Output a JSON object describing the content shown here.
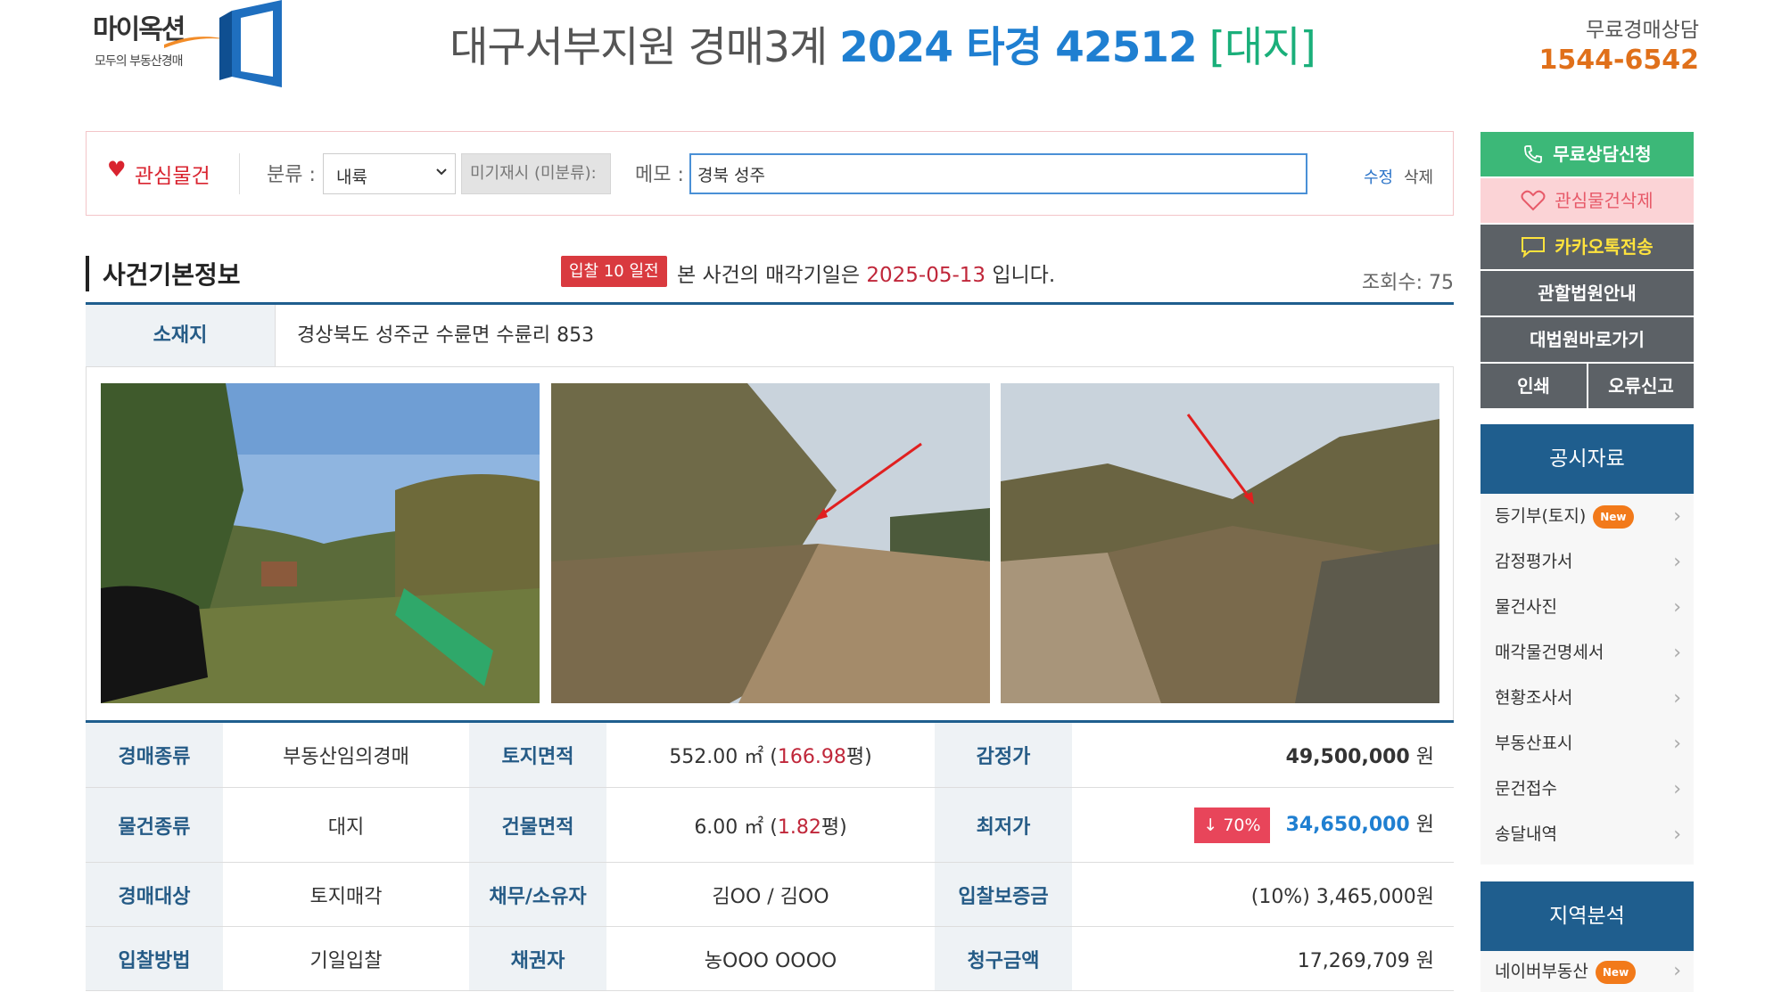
{
  "logo": {
    "main": "마이옥션",
    "sub": "모두의 부동산경매"
  },
  "header": {
    "court": "대구서부지원 경매3계",
    "case_no": "2024 타경 42512",
    "category": "[대지]",
    "consult_label": "무료경매상담",
    "consult_phone": "1544-6542"
  },
  "favorite": {
    "label": "관심물건",
    "category_label": "분류 :",
    "category_value": "내륙",
    "unclassified": "미기재시 (미분류):",
    "memo_label": "메모 :",
    "memo_value": "경북 성주",
    "edit": "수정",
    "delete": "삭제"
  },
  "section": {
    "title": "사건기본정보",
    "badge": "입찰 10 일전",
    "sale_prefix": "본 사건의 매각기일은",
    "sale_date": "2025-05-13",
    "sale_suffix": "입니다.",
    "view_count": "조회수: 75"
  },
  "location": {
    "label": "소재지",
    "value": "경상북도 성주군 수륜면 수륜리 853"
  },
  "info": {
    "r1": {
      "h1": "경매종류",
      "v1": "부동산임의경매",
      "h2": "토지면적",
      "v2_area": "552.00 ㎡ (",
      "v2_pyeong": "166.98",
      "v2_unit": "평)",
      "h3": "감정가",
      "v3_amount": "49,500,000",
      "v3_unit": "원"
    },
    "r2": {
      "h1": "물건종류",
      "v1": "대지",
      "h2": "건물면적",
      "v2_area": "6.00 ㎡ (",
      "v2_pyeong": "1.82",
      "v2_unit": "평)",
      "h3": "최저가",
      "v3_pct": "↓ 70%",
      "v3_amount": "34,650,000",
      "v3_unit": "원"
    },
    "r3": {
      "h1": "경매대상",
      "v1": "토지매각",
      "h2": "채무/소유자",
      "v2": "김OO / 김OO",
      "h3": "입찰보증금",
      "v3": "(10%) 3,465,000원"
    },
    "r4": {
      "h1": "입찰방법",
      "v1": "기일입찰",
      "h2": "채권자",
      "v2": "농OOO OOOO",
      "h3": "청구금액",
      "v3": "17,269,709 원"
    }
  },
  "sidebar": {
    "consult": "무료상담신청",
    "fav_delete": "관심물건삭제",
    "kakao": "카카오톡전송",
    "court_info": "관할법원안내",
    "supreme_court": "대법원바로가기",
    "print": "인쇄",
    "report_error": "오류신고",
    "notice": {
      "title": "공시자료",
      "items": [
        {
          "label": "등기부(토지)",
          "badge": "New"
        },
        {
          "label": "감정평가서"
        },
        {
          "label": "물건사진"
        },
        {
          "label": "매각물건명세서"
        },
        {
          "label": "현황조사서"
        },
        {
          "label": "부동산표시"
        },
        {
          "label": "문건접수"
        },
        {
          "label": "송달내역"
        }
      ]
    },
    "region": {
      "title": "지역분석",
      "items": [
        {
          "label": "네이버부동산",
          "badge": "New"
        }
      ]
    }
  },
  "colors": {
    "primary_blue": "#1f7fd1",
    "navy": "#1f5e8e",
    "accent_red": "#c0273a",
    "consult_green": "#3cb878",
    "phone_orange": "#e0701a"
  }
}
